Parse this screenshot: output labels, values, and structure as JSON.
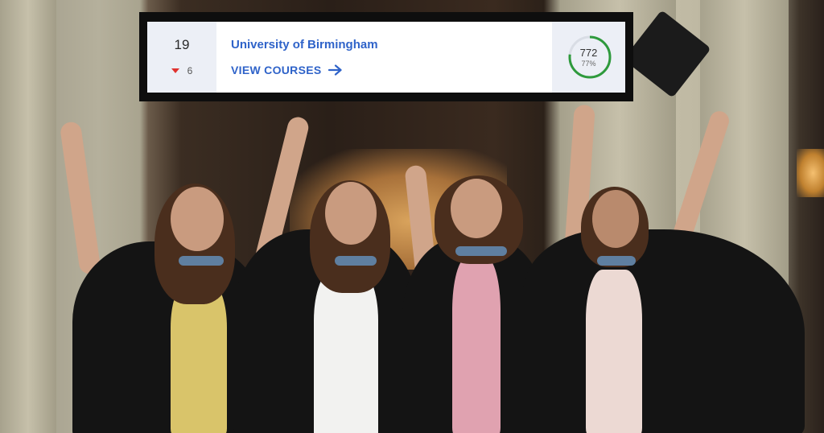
{
  "ranking_card": {
    "rank": "19",
    "rank_change": "6",
    "rank_change_direction": "down",
    "university_name": "University of Birmingham",
    "view_courses_label": "VIEW COURSES",
    "score": "772",
    "score_percent_label": "77%",
    "score_fraction": 0.77,
    "colors": {
      "accent_blue": "#2f63c9",
      "score_ring_green": "#2e9a3c",
      "down_red": "#e0322f",
      "panel_bg": "#eceff6"
    },
    "icons": {
      "change": "triangle-down-icon",
      "view_courses": "arrow-right-icon"
    }
  },
  "background_photo": {
    "subject": "graduates-throwing-caps"
  }
}
